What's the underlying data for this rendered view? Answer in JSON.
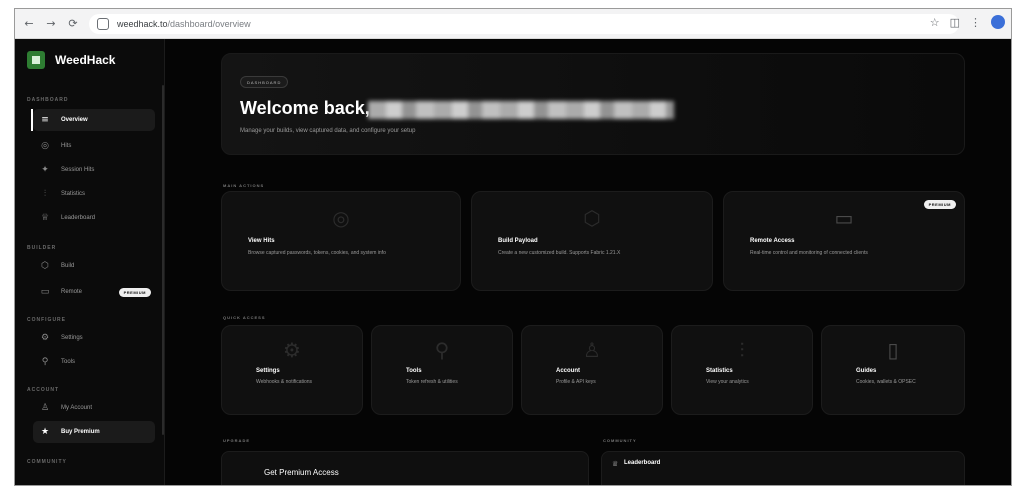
{
  "browser": {
    "url_host": "weedhack.to",
    "url_path": "/dashboard/overview",
    "nav": {
      "back": "←",
      "forward": "→",
      "reload": "⟳"
    },
    "icons": {
      "star": "☆",
      "panel": "◫",
      "menu": "⋮"
    }
  },
  "brand": {
    "name": "WeedHack",
    "color": "#2e7d32"
  },
  "sidebar": {
    "sections": {
      "dashboard": "DASHBOARD",
      "builder": "BUILDER",
      "configure": "CONFIGURE",
      "account": "ACCOUNT",
      "community": "COMMUNITY"
    },
    "items": {
      "overview": {
        "label": "Overview",
        "icon": "menu-icon"
      },
      "hits": {
        "label": "Hits",
        "icon": "target-icon"
      },
      "session_hits": {
        "label": "Session Hits",
        "icon": "pulse-icon"
      },
      "statistics": {
        "label": "Statistics",
        "icon": "bar-chart-icon"
      },
      "leaderboard": {
        "label": "Leaderboard",
        "icon": "trophy-icon"
      },
      "build": {
        "label": "Build",
        "icon": "package-icon"
      },
      "remote": {
        "label": "Remote",
        "icon": "monitor-icon",
        "badge": "PREMIUM"
      },
      "settings": {
        "label": "Settings",
        "icon": "gear-icon"
      },
      "tools": {
        "label": "Tools",
        "icon": "wrench-icon"
      },
      "my_account": {
        "label": "My Account",
        "icon": "user-icon"
      },
      "buy_premium": {
        "label": "Buy Premium",
        "icon": "star-icon"
      }
    }
  },
  "hero": {
    "badge": "DASHBOARD",
    "title": "Welcome back,",
    "subtitle": "Manage your builds, view captured data, and configure your setup"
  },
  "main_actions": {
    "label": "MAIN ACTIONS",
    "cards": [
      {
        "title": "View Hits",
        "desc": "Browse captured passwords, tokens, cookies, and system info",
        "icon": "target-icon"
      },
      {
        "title": "Build Payload",
        "desc": "Create a new customized build. Supports Fabric 1.21.X",
        "icon": "package-icon"
      },
      {
        "title": "Remote Access",
        "desc": "Real-time control and monitoring of connected clients",
        "icon": "monitor-icon",
        "badge": "PREMIUM"
      }
    ]
  },
  "quick_access": {
    "label": "QUICK ACCESS",
    "cards": [
      {
        "title": "Settings",
        "desc": "Webhooks & notifications",
        "icon": "gear-icon"
      },
      {
        "title": "Tools",
        "desc": "Token refresh & utilities",
        "icon": "wrench-icon"
      },
      {
        "title": "Account",
        "desc": "Profile & API keys",
        "icon": "user-icon"
      },
      {
        "title": "Statistics",
        "desc": "View your analytics",
        "icon": "bar-chart-icon"
      },
      {
        "title": "Guides",
        "desc": "Cookies, wallets & OPSEC",
        "icon": "book-icon"
      }
    ]
  },
  "upgrade": {
    "label": "UPGRADE",
    "title": "Get Premium Access"
  },
  "community": {
    "label": "COMMUNITY",
    "leaderboard": "Leaderboard"
  }
}
